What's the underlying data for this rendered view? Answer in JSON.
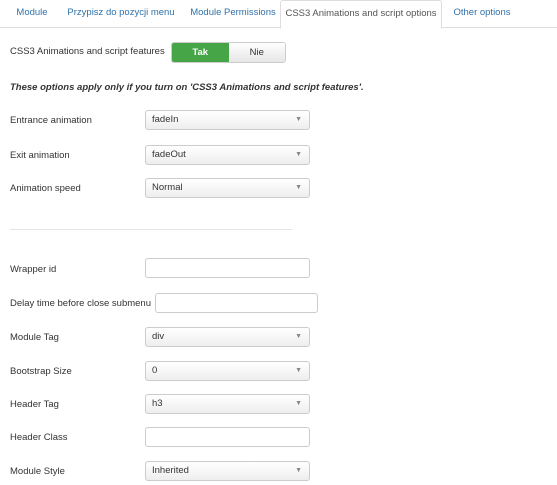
{
  "tabs": [
    "Module",
    "Przypisz do pozycji menu",
    "Module Permissions",
    "CSS3 Animations and script options",
    "Other options"
  ],
  "css3": {
    "label": "CSS3 Animations and script features",
    "on": "Tak",
    "off": "Nie",
    "selected": "Tak"
  },
  "note": "These options apply only if you turn on 'CSS3 Animations and script features'.",
  "fields": {
    "entrance": {
      "label": "Entrance animation",
      "value": "fadeIn"
    },
    "exit": {
      "label": "Exit animation",
      "value": "fadeOut"
    },
    "speed": {
      "label": "Animation speed",
      "value": "Normal"
    },
    "wrapper": {
      "label": "Wrapper id",
      "value": ""
    },
    "delay": {
      "label": "Delay time before close submenu",
      "value": ""
    },
    "module_tag": {
      "label": "Module Tag",
      "value": "div"
    },
    "bootstrap": {
      "label": "Bootstrap Size",
      "value": "0"
    },
    "header_tag": {
      "label": "Header Tag",
      "value": "h3"
    },
    "header_class": {
      "label": "Header Class",
      "value": ""
    },
    "module_style": {
      "label": "Module Style",
      "value": "Inherited"
    }
  },
  "colors": {
    "active_green": "#46a546",
    "link": "#3071a9"
  }
}
